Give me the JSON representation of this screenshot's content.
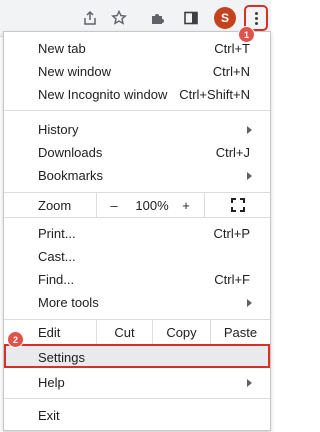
{
  "toolbar": {
    "icons": [
      "share-icon",
      "bookmark-star-icon",
      "extensions-icon",
      "side-panel-icon"
    ],
    "avatar_letter": "S",
    "menu_button_icon": "kebab-menu-icon"
  },
  "badges": {
    "step1": "1",
    "step2": "2"
  },
  "menu": {
    "new_tab": {
      "label": "New tab",
      "shortcut": "Ctrl+T"
    },
    "new_window": {
      "label": "New window",
      "shortcut": "Ctrl+N"
    },
    "incognito": {
      "label": "New Incognito window",
      "shortcut": "Ctrl+Shift+N"
    },
    "history": {
      "label": "History"
    },
    "downloads": {
      "label": "Downloads",
      "shortcut": "Ctrl+J"
    },
    "bookmarks": {
      "label": "Bookmarks"
    },
    "zoom": {
      "label": "Zoom",
      "minus": "–",
      "value": "100%",
      "plus": "+"
    },
    "print": {
      "label": "Print...",
      "shortcut": "Ctrl+P"
    },
    "cast": {
      "label": "Cast..."
    },
    "find": {
      "label": "Find...",
      "shortcut": "Ctrl+F"
    },
    "more_tools": {
      "label": "More tools"
    },
    "edit": {
      "label": "Edit",
      "cut": "Cut",
      "copy": "Copy",
      "paste": "Paste"
    },
    "settings": {
      "label": "Settings"
    },
    "help": {
      "label": "Help"
    },
    "exit": {
      "label": "Exit"
    }
  },
  "colors": {
    "highlight_border": "#d93025",
    "badge": "#e0534b",
    "avatar": "#c5421f"
  }
}
